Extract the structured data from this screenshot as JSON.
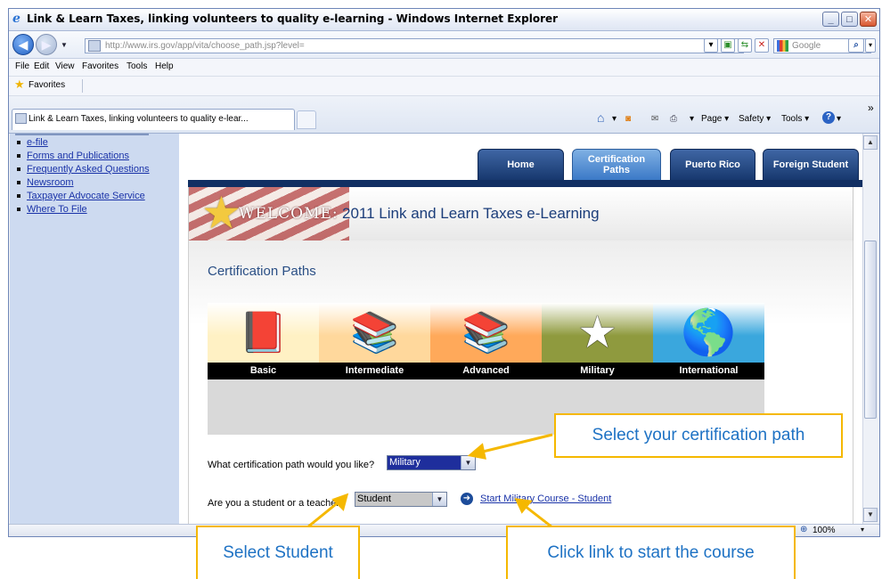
{
  "window": {
    "title": "Link & Learn Taxes, linking volunteers to quality e-learning - Windows Internet Explorer",
    "minimize_label": "_",
    "maximize_label": "□",
    "close_label": "✕"
  },
  "address_bar": {
    "url": "http://www.irs.gov/app/vita/choose_path.jsp?level=",
    "search_placeholder": "Google"
  },
  "menu": [
    "File",
    "Edit",
    "View",
    "Favorites",
    "Tools",
    "Help"
  ],
  "favorites_label": "Favorites",
  "tab": {
    "title": "Link & Learn Taxes, linking volunteers to quality e-lear..."
  },
  "command_bar": {
    "page_label": "Page ▾",
    "safety_label": "Safety ▾",
    "tools_label": "Tools ▾",
    "more": "»"
  },
  "left_nav": [
    "e-file",
    "Forms and Publications",
    "Frequently Asked Questions",
    "Newsroom",
    "Taxpayer Advocate Service",
    "Where To File"
  ],
  "site_tabs": {
    "home": "Home",
    "cert_line1": "Certification",
    "cert_line2": "Paths",
    "puerto_rico": "Puerto Rico",
    "foreign": "Foreign Student"
  },
  "banner": {
    "welcome": "WELCOME:",
    "title": "2011 Link and Learn Taxes e-Learning"
  },
  "certification": {
    "heading": "Certification Paths",
    "paths": [
      "Basic",
      "Intermediate",
      "Advanced",
      "Military",
      "International"
    ],
    "tile_colors": [
      "#fff1c4",
      "#ffd89c",
      "#ffa95a",
      "#8f9a3e",
      "#3aa7dd"
    ],
    "question_path": "What certification path would you like?",
    "selected_path": "Military",
    "question_role": "Are you a student or a teacher?",
    "selected_role": "Student",
    "start_link": "Start Military Course - Student"
  },
  "status_bar": {
    "zoom": "100%"
  },
  "callouts": {
    "path": "Select your certification path",
    "student": "Select Student",
    "link": "Click link to start the course"
  }
}
